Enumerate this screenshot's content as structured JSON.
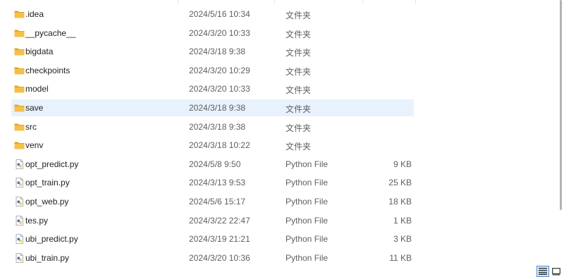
{
  "files": [
    {
      "name": ".idea",
      "date": "2024/5/16 10:34",
      "type": "文件夹",
      "size": "",
      "kind": "folder"
    },
    {
      "name": "__pycache__",
      "date": "2024/3/20 10:33",
      "type": "文件夹",
      "size": "",
      "kind": "folder"
    },
    {
      "name": "bigdata",
      "date": "2024/3/18 9:38",
      "type": "文件夹",
      "size": "",
      "kind": "folder"
    },
    {
      "name": "checkpoints",
      "date": "2024/3/20 10:29",
      "type": "文件夹",
      "size": "",
      "kind": "folder"
    },
    {
      "name": "model",
      "date": "2024/3/20 10:33",
      "type": "文件夹",
      "size": "",
      "kind": "folder"
    },
    {
      "name": "save",
      "date": "2024/3/18 9:38",
      "type": "文件夹",
      "size": "",
      "kind": "folder",
      "selected": true
    },
    {
      "name": "src",
      "date": "2024/3/18 9:38",
      "type": "文件夹",
      "size": "",
      "kind": "folder"
    },
    {
      "name": "venv",
      "date": "2024/3/18 10:22",
      "type": "文件夹",
      "size": "",
      "kind": "folder"
    },
    {
      "name": "opt_predict.py",
      "date": "2024/5/8 9:50",
      "type": "Python File",
      "size": "9 KB",
      "kind": "python"
    },
    {
      "name": "opt_train.py",
      "date": "2024/3/13 9:53",
      "type": "Python File",
      "size": "25 KB",
      "kind": "python"
    },
    {
      "name": "opt_web.py",
      "date": "2024/5/6 15:17",
      "type": "Python File",
      "size": "18 KB",
      "kind": "python"
    },
    {
      "name": "tes.py",
      "date": "2024/3/22 22:47",
      "type": "Python File",
      "size": "1 KB",
      "kind": "python"
    },
    {
      "name": "ubi_predict.py",
      "date": "2024/3/19 21:21",
      "type": "Python File",
      "size": "3 KB",
      "kind": "python"
    },
    {
      "name": "ubi_train.py",
      "date": "2024/3/20 10:36",
      "type": "Python File",
      "size": "11 KB",
      "kind": "python"
    }
  ],
  "colors": {
    "folder": "#f5c04a",
    "folder_dark": "#e0a526",
    "selected_row": "#e8f2fc",
    "python_blue": "#3b77b5",
    "python_yellow": "#f2c94c"
  },
  "view_modes": {
    "active": "details",
    "icons": [
      "details-view-icon",
      "large-icons-view-icon"
    ]
  }
}
